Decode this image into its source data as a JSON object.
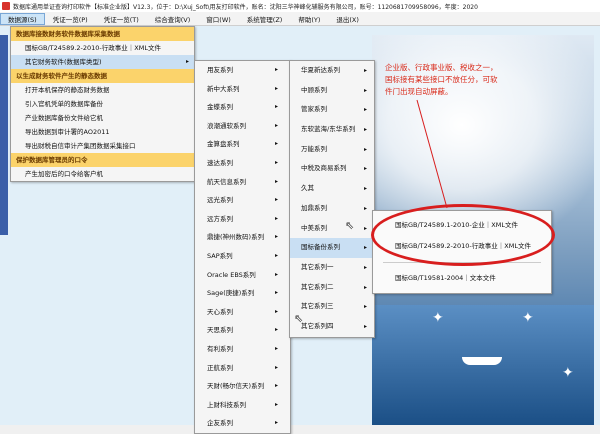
{
  "window": {
    "title": "数据库通用单证查询打印软件【标准企业版】V12.3，位于：D:\\Xuj_Soft\\用友打印软件，账名：沈阳三华神峰化辅服务有限公司，账号：1120681709958096，年度：2020"
  },
  "menubar": {
    "items": [
      "数据源(S)",
      "凭证一览(P)",
      "凭证一览(T)",
      "综合查询(V)",
      "窗口(W)",
      "系统管理(Z)",
      "帮助(Y)",
      "退出(X)"
    ]
  },
  "menu_level1": [
    {
      "label": "数据库接数财务软件数据库采集数据",
      "type": "header"
    },
    {
      "label": "国标GB/T24589.2-2010-行政事业｜XML文件",
      "type": "sub"
    },
    {
      "label": "其它财务软件(数据库类型)",
      "type": "selected",
      "arrow": "▸"
    },
    {
      "label": "以生成财务软件产生的静态数据",
      "type": "header"
    },
    {
      "label": "打开本机保存的静态财务数据",
      "type": "sub"
    },
    {
      "label": "引入官机凭单的数据库备份",
      "type": "sub"
    },
    {
      "label": "产业数据库备份文件给它机",
      "type": "sub"
    },
    {
      "label": "导出数据到审计署的AO2011",
      "type": "sub"
    },
    {
      "label": "导出财税自信审计产集团数据采集接口",
      "type": "sub"
    },
    {
      "label": "保护数据库管理员的口令",
      "type": "header"
    },
    {
      "label": "产生加密后的口令给客户机",
      "type": "sub"
    }
  ],
  "menu_level2": [
    "用友系列",
    "新中大系列",
    "金蝶系列",
    "浪潮通软系列",
    "金算盘系列",
    "速达系列",
    "航天信息系列",
    "远光系列",
    "远方系列",
    "鼎捷(神州数码)系列",
    "SAP系列",
    "Oracle EBS系列",
    "Sage(庚捷)系列",
    "天心系列",
    "天思系列",
    "有利系列",
    "正航系列",
    "天财(畅尔信天)系列",
    "上财科技系列",
    "企友系列"
  ],
  "menu_level3": [
    {
      "label": "华夏新达系列",
      "arrow": true,
      "selected": false
    },
    {
      "label": "中顾系列",
      "arrow": true,
      "selected": false
    },
    {
      "label": "管家系列",
      "arrow": true,
      "selected": false
    },
    {
      "label": "东软蓝海/东华系列",
      "arrow": true,
      "selected": false
    },
    {
      "label": "万能系列",
      "arrow": true,
      "selected": false
    },
    {
      "label": "中税及商易系列",
      "arrow": true,
      "selected": false
    },
    {
      "label": "久其",
      "arrow": true,
      "selected": false
    },
    {
      "label": "加鼎系列",
      "arrow": true,
      "selected": false
    },
    {
      "label": "中美系列",
      "arrow": true,
      "selected": false
    },
    {
      "label": "国标备份系列",
      "arrow": true,
      "selected": true
    },
    {
      "label": "其它系列一",
      "arrow": true,
      "selected": false
    },
    {
      "label": "其它系列二",
      "arrow": true,
      "selected": false
    },
    {
      "label": "其它系列三",
      "arrow": true,
      "selected": false
    },
    {
      "label": "其它系列四",
      "arrow": true,
      "selected": false
    }
  ],
  "menu_level4": [
    "国标GB/T24589.1-2010-企业｜XML文件",
    "国标GB/T24589.2-2010-行政事业｜XML文件",
    "国标GB/T19581-2004｜文本文件"
  ],
  "annotation": "企业版、行政事业版、税收之一，国标接有某些接口不放任分，可软件门出现自动屏蔽。",
  "colors": {
    "accent_header": "#fbd36b",
    "selection": "#c9dff3",
    "annotation_red": "#d92a1a"
  }
}
